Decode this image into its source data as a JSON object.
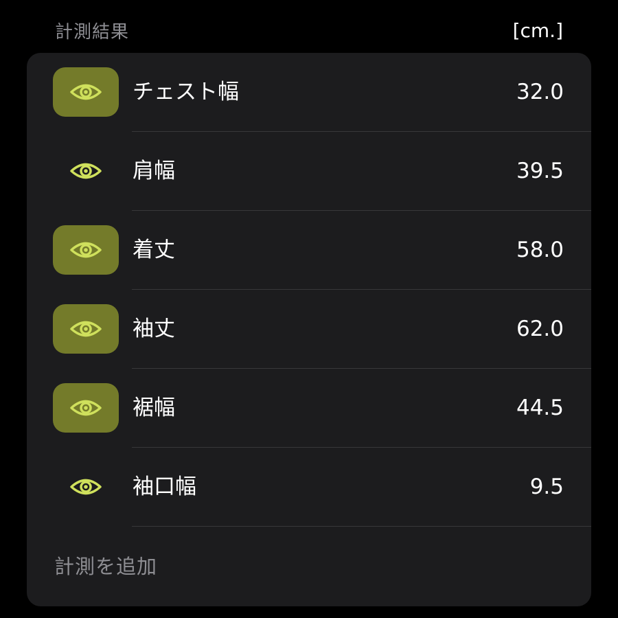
{
  "header": {
    "title": "計測結果",
    "unit": "[cm.]"
  },
  "colors": {
    "accent": "#cfe05c",
    "active_bg": "#747b2a",
    "card_bg": "#1c1c1e"
  },
  "measurements": [
    {
      "label": "チェスト幅",
      "value": "32.0",
      "highlighted": true,
      "icon": "eye-icon"
    },
    {
      "label": "肩幅",
      "value": "39.5",
      "highlighted": false,
      "icon": "eye-icon"
    },
    {
      "label": "着丈",
      "value": "58.0",
      "highlighted": true,
      "icon": "eye-icon"
    },
    {
      "label": "袖丈",
      "value": "62.0",
      "highlighted": true,
      "icon": "eye-icon"
    },
    {
      "label": "裾幅",
      "value": "44.5",
      "highlighted": true,
      "icon": "eye-icon"
    },
    {
      "label": "袖口幅",
      "value": "9.5",
      "highlighted": false,
      "icon": "eye-icon"
    }
  ],
  "add_action": {
    "label": "計測を追加"
  }
}
